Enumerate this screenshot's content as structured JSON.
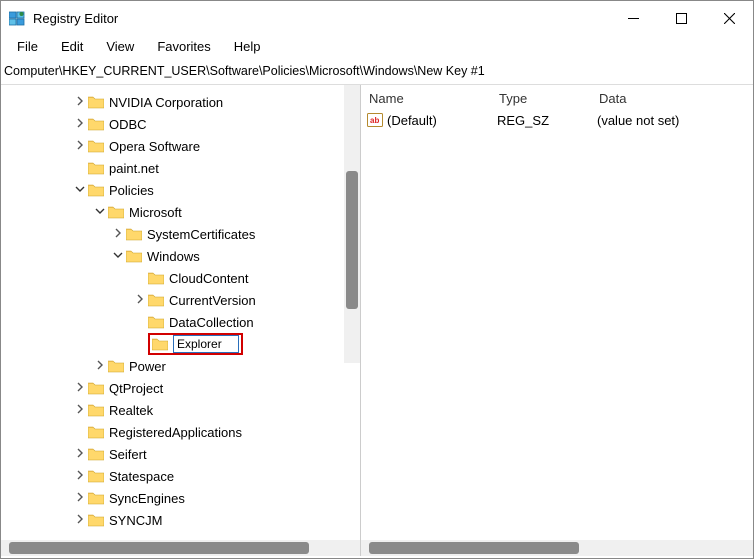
{
  "window": {
    "title": "Registry Editor"
  },
  "menu": {
    "file": "File",
    "edit": "Edit",
    "view": "View",
    "favorites": "Favorites",
    "help": "Help"
  },
  "address": "Computer\\HKEY_CURRENT_USER\\Software\\Policies\\Microsoft\\Windows\\New Key #1",
  "tree": {
    "items": [
      {
        "indent": 72,
        "expander": "right",
        "label": "NVIDIA Corporation"
      },
      {
        "indent": 72,
        "expander": "right",
        "label": "ODBC"
      },
      {
        "indent": 72,
        "expander": "right",
        "label": "Opera Software"
      },
      {
        "indent": 72,
        "expander": "none",
        "label": "paint.net"
      },
      {
        "indent": 72,
        "expander": "down",
        "label": "Policies"
      },
      {
        "indent": 92,
        "expander": "down",
        "label": "Microsoft"
      },
      {
        "indent": 110,
        "expander": "right",
        "label": "SystemCertificates"
      },
      {
        "indent": 110,
        "expander": "down",
        "label": "Windows"
      },
      {
        "indent": 132,
        "expander": "none",
        "label": "CloudContent"
      },
      {
        "indent": 132,
        "expander": "right",
        "label": "CurrentVersion"
      },
      {
        "indent": 132,
        "expander": "none",
        "label": "DataCollection"
      },
      {
        "indent": 132,
        "expander": "none",
        "label": "Explorer",
        "editing": true
      },
      {
        "indent": 92,
        "expander": "right",
        "label": "Power"
      },
      {
        "indent": 72,
        "expander": "right",
        "label": "QtProject"
      },
      {
        "indent": 72,
        "expander": "right",
        "label": "Realtek"
      },
      {
        "indent": 72,
        "expander": "none",
        "label": "RegisteredApplications"
      },
      {
        "indent": 72,
        "expander": "right",
        "label": "Seifert"
      },
      {
        "indent": 72,
        "expander": "right",
        "label": "Statespace"
      },
      {
        "indent": 72,
        "expander": "right",
        "label": "SyncEngines"
      },
      {
        "indent": 72,
        "expander": "right",
        "label": "SYNCJM"
      }
    ]
  },
  "list": {
    "headers": {
      "name": "Name",
      "type": "Type",
      "data": "Data"
    },
    "rows": [
      {
        "name": "(Default)",
        "type": "REG_SZ",
        "data": "(value not set)"
      }
    ]
  }
}
